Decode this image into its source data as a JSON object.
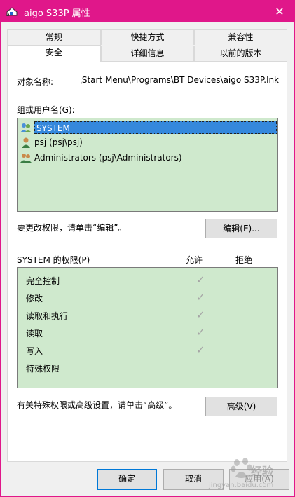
{
  "window": {
    "title": "aigo S33P 属性",
    "close_glyph": "✕"
  },
  "tabs": [
    {
      "label": "常规"
    },
    {
      "label": "快捷方式"
    },
    {
      "label": "兼容性"
    },
    {
      "label": "安全"
    },
    {
      "label": "详细信息"
    },
    {
      "label": "以前的版本"
    }
  ],
  "security": {
    "object_name_label": "对象名称:",
    "object_name_value": "\\Start Menu\\Programs\\BT Devices\\aigo S33P.lnk",
    "object_name_prefix": "s",
    "group_label": "组或用户名(G):",
    "principals": [
      {
        "name": "SYSTEM",
        "icon": "users-group-icon",
        "selected": true
      },
      {
        "name": "psj (psj\\psj)",
        "icon": "user-icon",
        "selected": false
      },
      {
        "name": "Administrators (psj\\Administrators)",
        "icon": "users-group-icon",
        "selected": false
      }
    ],
    "edit_hint": "要更改权限，请单击“编辑”。",
    "edit_button": "编辑(E)...",
    "permissions_label": "SYSTEM 的权限(P)",
    "allow_header": "允许",
    "deny_header": "拒绝",
    "permissions": [
      {
        "name": "完全控制",
        "allow": true,
        "deny": false
      },
      {
        "name": "修改",
        "allow": true,
        "deny": false
      },
      {
        "name": "读取和执行",
        "allow": true,
        "deny": false
      },
      {
        "name": "读取",
        "allow": true,
        "deny": false
      },
      {
        "name": "写入",
        "allow": true,
        "deny": false
      },
      {
        "name": "特殊权限",
        "allow": false,
        "deny": false
      }
    ],
    "check_glyph": "✓",
    "advanced_hint": "有关特殊权限或高级设置，请单击“高级”。",
    "advanced_button": "高级(V)"
  },
  "footer": {
    "ok_button": "确定",
    "cancel_button": "取消",
    "apply_button": "应用(A)"
  },
  "watermark": {
    "brand": "经验",
    "sub": "jingyan.baidu.com"
  },
  "colors": {
    "titlebar": "#e0178a",
    "list_bg": "#cfe9cd",
    "selected": "#3588dc"
  }
}
